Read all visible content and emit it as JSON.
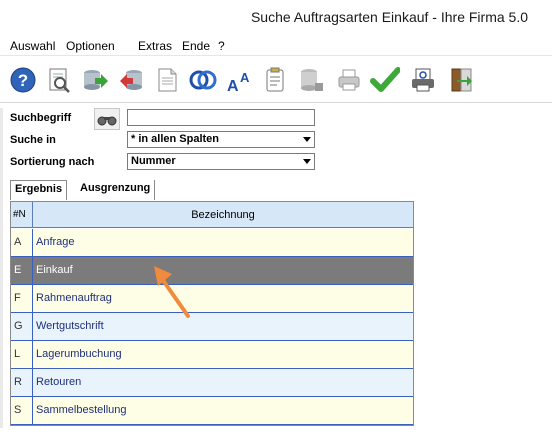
{
  "window": {
    "title": "Suche Auftragsarten Einkauf - Ihre Firma 5.0"
  },
  "menu": [
    "Auswahl",
    "Optionen",
    "Extras",
    "Ende",
    "?"
  ],
  "toolbar_icons": [
    "help-icon",
    "preview-icon",
    "export-icon",
    "import-icon",
    "document-icon",
    "rings-icon",
    "font-size-icon",
    "clipboard-icon",
    "database-icon",
    "printer-icon",
    "checkmark-icon",
    "print-preview-icon",
    "exit-door-icon"
  ],
  "search": {
    "label_term": "Suchbegriff",
    "term_value": "",
    "label_in": "Suche in",
    "in_value": "* in allen Spalten",
    "label_sort": "Sortierung nach",
    "sort_value": "Nummer"
  },
  "tabs": [
    "Ergebnis",
    "Ausgrenzung"
  ],
  "grid": {
    "headers": [
      "#N",
      "Bezeichnung"
    ],
    "rows": [
      {
        "code": "A",
        "name": "Anfrage"
      },
      {
        "code": "E",
        "name": "Einkauf"
      },
      {
        "code": "F",
        "name": "Rahmenauftrag"
      },
      {
        "code": "G",
        "name": "Wertgutschrift"
      },
      {
        "code": "L",
        "name": "Lagerumbuchung"
      },
      {
        "code": "R",
        "name": "Retouren"
      },
      {
        "code": "S",
        "name": "Sammelbestellung"
      }
    ],
    "selected_index": 1
  },
  "colors": {
    "header_bg": "#d6e8f8",
    "row_odd": "#fefee6",
    "row_even": "#e9f3fc",
    "row_selected": "#7b7b7b",
    "annotation_arrow": "#f08a3c"
  }
}
